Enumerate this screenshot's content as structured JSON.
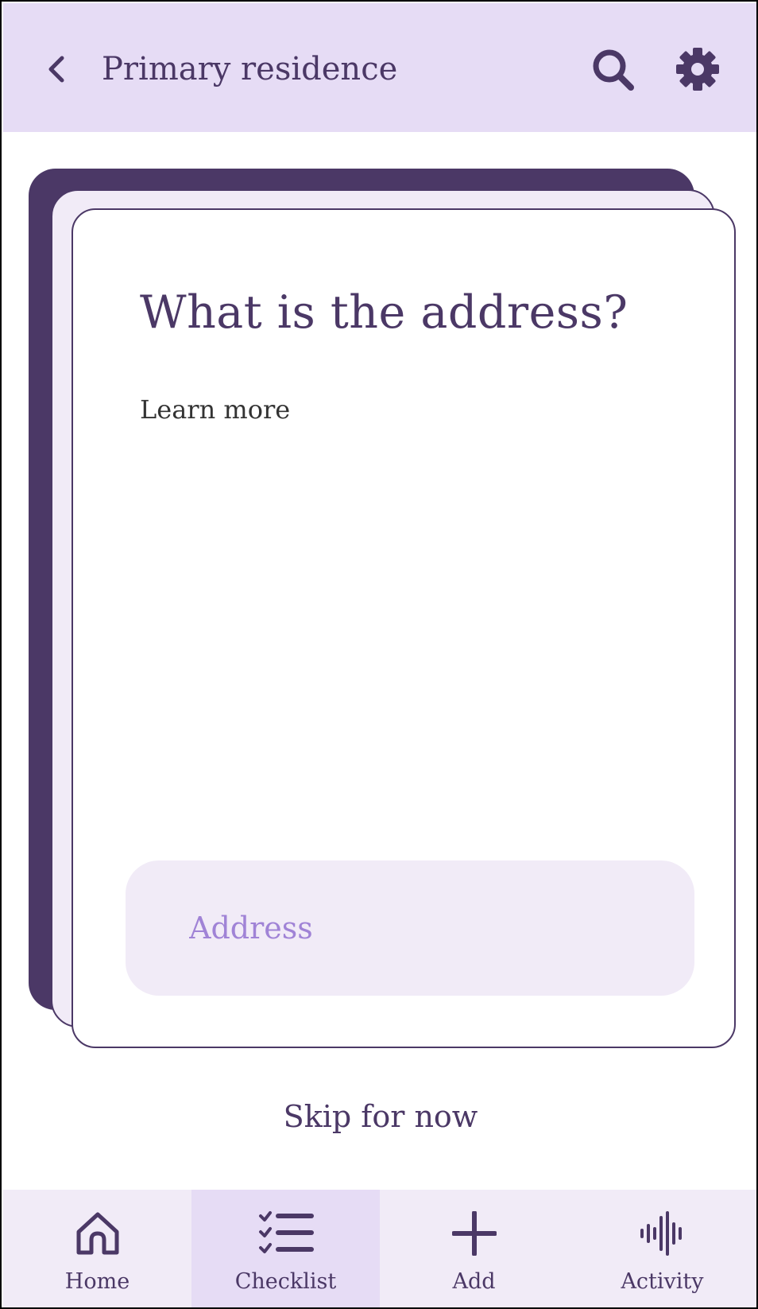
{
  "appbar": {
    "title": "Primary residence",
    "back_icon": "chevron-left-icon",
    "search_icon": "search-icon",
    "settings_icon": "gear-icon"
  },
  "card": {
    "question": "What is the address?",
    "learn_more": "Learn more",
    "input": {
      "placeholder": "Address",
      "value": ""
    }
  },
  "skip_label": "Skip for now",
  "nav": {
    "items": [
      {
        "label": "Home",
        "icon": "home-icon"
      },
      {
        "label": "Checklist",
        "icon": "checklist-icon",
        "active": true
      },
      {
        "label": "Add",
        "icon": "plus-icon"
      },
      {
        "label": "Activity",
        "icon": "waveform-icon"
      }
    ]
  },
  "colors": {
    "primary": "#4b3866",
    "appbar_bg": "#e6dcf5",
    "surface_tint": "#f1ebf7",
    "placeholder": "#a083d6"
  }
}
